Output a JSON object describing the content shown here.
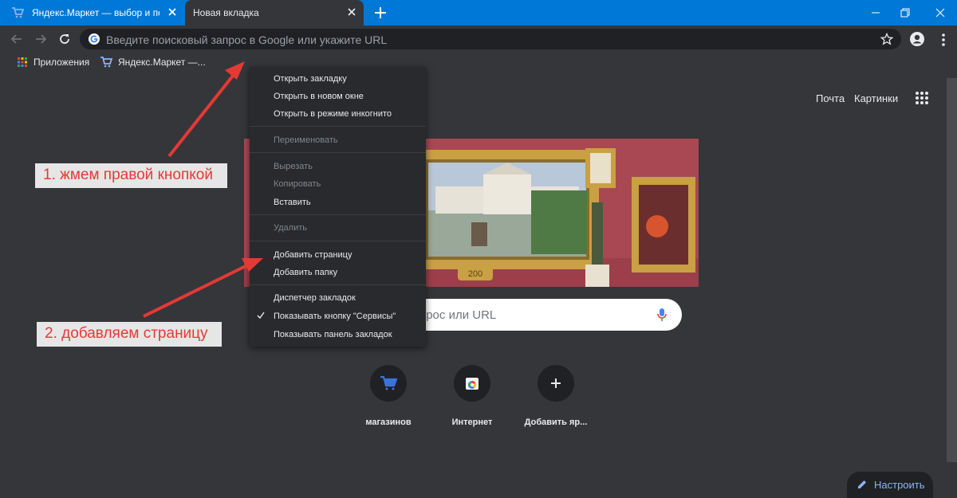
{
  "tabs": [
    {
      "title": "Яндекс.Маркет — выбор и покупка товаров"
    },
    {
      "title": "Новая вкладка"
    }
  ],
  "omnibox": {
    "placeholder": "Введите поисковый запрос в Google или укажите URL"
  },
  "bookmarks": {
    "apps_label": "Приложения",
    "market_label": "Яндекс.Маркет —..."
  },
  "ntp": {
    "mail_link": "Почта",
    "images_link": "Картинки",
    "search_placeholder": "Введите поисковый запрос или URL",
    "shortcuts": [
      {
        "label": "магазинов"
      },
      {
        "label": "Интернет"
      },
      {
        "label": "Добавить яр..."
      }
    ],
    "customize_label": "Настроить",
    "doodle_badge": "200"
  },
  "context_menu": {
    "items": [
      {
        "label": "Открыть закладку",
        "enabled": true
      },
      {
        "label": "Открыть в новом окне",
        "enabled": true
      },
      {
        "label": "Открыть в режиме инкогнито",
        "enabled": true
      },
      {
        "label": "Переименовать",
        "enabled": false
      },
      {
        "label": "Вырезать",
        "enabled": false
      },
      {
        "label": "Копировать",
        "enabled": false
      },
      {
        "label": "Вставить",
        "enabled": true
      },
      {
        "label": "Удалить",
        "enabled": false
      },
      {
        "label": "Добавить страницу",
        "enabled": true
      },
      {
        "label": "Добавить папку",
        "enabled": true
      },
      {
        "label": "Диспетчер закладок",
        "enabled": true
      },
      {
        "label": "Показывать кнопку \"Сервисы\"",
        "enabled": true,
        "checked": true
      },
      {
        "label": "Показывать панель закладок",
        "enabled": true
      }
    ]
  },
  "annotations": [
    {
      "text": "1. жмем правой кнопкой"
    },
    {
      "text": "2. добавляем страницу"
    }
  ],
  "colors": {
    "titlebar": "#0078d7",
    "chrome_dark": "#35363a",
    "omnibox": "#202124",
    "annotation_text": "#e53935",
    "annotation_bg": "#e6e6e6",
    "doodle_bg": "#a94853"
  }
}
